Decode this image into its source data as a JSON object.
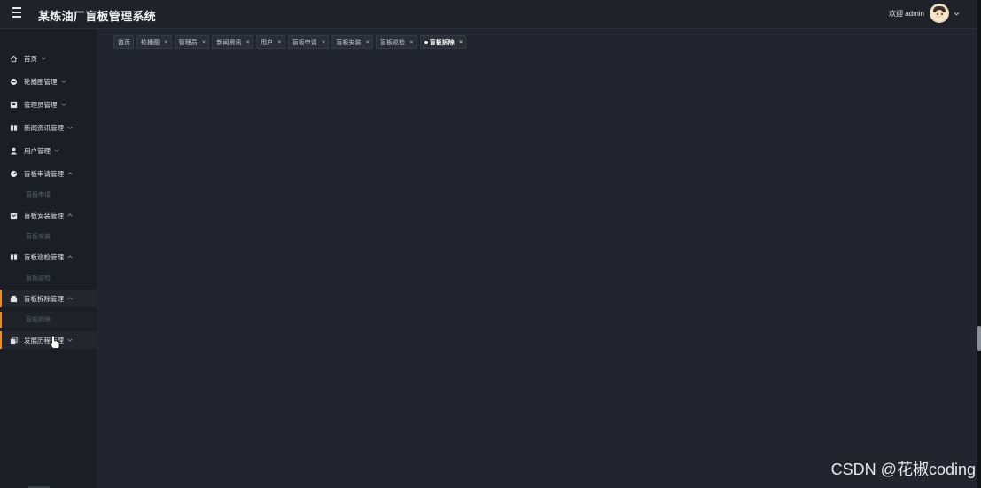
{
  "header": {
    "app_title": "某炼油厂盲板管理系统",
    "welcome": "欢迎 admin",
    "menu_icon": "hamburger-icon",
    "avatar_icon": "user-avatar"
  },
  "sidebar": {
    "items": [
      {
        "label": "首页",
        "icon": "home-icon",
        "caret": "down"
      },
      {
        "label": "轮播图管理",
        "icon": "carousel-icon",
        "caret": "down"
      },
      {
        "label": "管理员管理",
        "icon": "admin-icon",
        "caret": "down"
      },
      {
        "label": "新闻资讯管理",
        "icon": "news-icon",
        "caret": "down"
      },
      {
        "label": "用户管理",
        "icon": "user-icon",
        "caret": "down"
      },
      {
        "label": "盲板申请管理",
        "icon": "apply-icon",
        "caret": "up",
        "sub": "盲板申请"
      },
      {
        "label": "盲板安装管理",
        "icon": "install-icon",
        "caret": "up",
        "sub": "盲板安装"
      },
      {
        "label": "盲板巡检管理",
        "icon": "inspect-icon",
        "caret": "up",
        "sub": "盲板巡检"
      },
      {
        "label": "盲板拆除管理",
        "icon": "remove-icon",
        "caret": "up",
        "sub": "盲板拆除"
      },
      {
        "label": "发展历程管理",
        "icon": "history-icon",
        "caret": "down"
      }
    ]
  },
  "tabs": [
    {
      "label": "首页",
      "closable": false
    },
    {
      "label": "轮播图",
      "closable": true
    },
    {
      "label": "管理员",
      "closable": true
    },
    {
      "label": "新闻资讯",
      "closable": true
    },
    {
      "label": "用户",
      "closable": true
    },
    {
      "label": "盲板申请",
      "closable": true
    },
    {
      "label": "盲板安装",
      "closable": true
    },
    {
      "label": "盲板巡检",
      "closable": true
    },
    {
      "label": "盲板拆除",
      "closable": true,
      "active": true
    }
  ],
  "tab_close_glyph": "×",
  "watermark": "CSDN @花椒coding",
  "colors": {
    "accent": "#f08a24",
    "background": "#22252d",
    "sidebar": "#1b1e25",
    "topbar": "#1f2229"
  }
}
